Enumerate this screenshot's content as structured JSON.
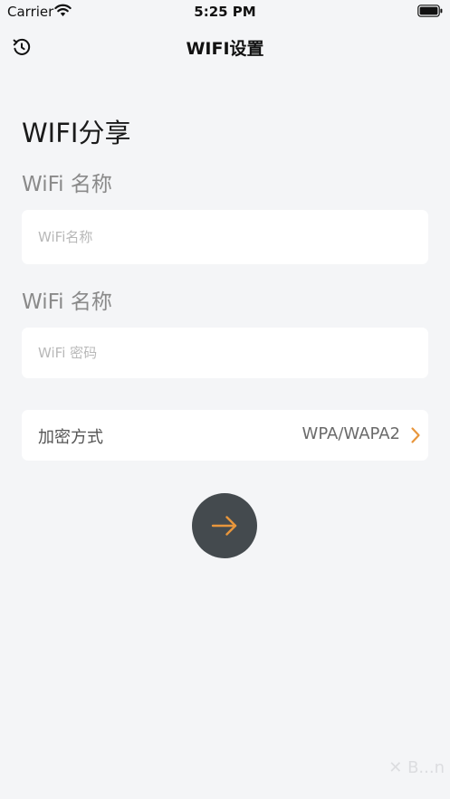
{
  "status_bar": {
    "carrier": "Carrier",
    "time": "5:25 PM"
  },
  "nav": {
    "title": "WIFI设置",
    "left_icon": "refresh-icon"
  },
  "main": {
    "section_title": "WIFI分享",
    "ssid_label": "WiFi 名称",
    "ssid_placeholder": "WiFi名称",
    "password_label": "WiFi 名称",
    "password_placeholder": "WiFi 密码",
    "encryption_label": "加密方式",
    "encryption_value": "WPA/WAPA2",
    "next_icon": "arrow-right-icon"
  },
  "watermark": "✕ B...n",
  "colors": {
    "background": "#f4f5f7",
    "card": "#ffffff",
    "accent": "#e8963c",
    "button": "#444a4e"
  }
}
